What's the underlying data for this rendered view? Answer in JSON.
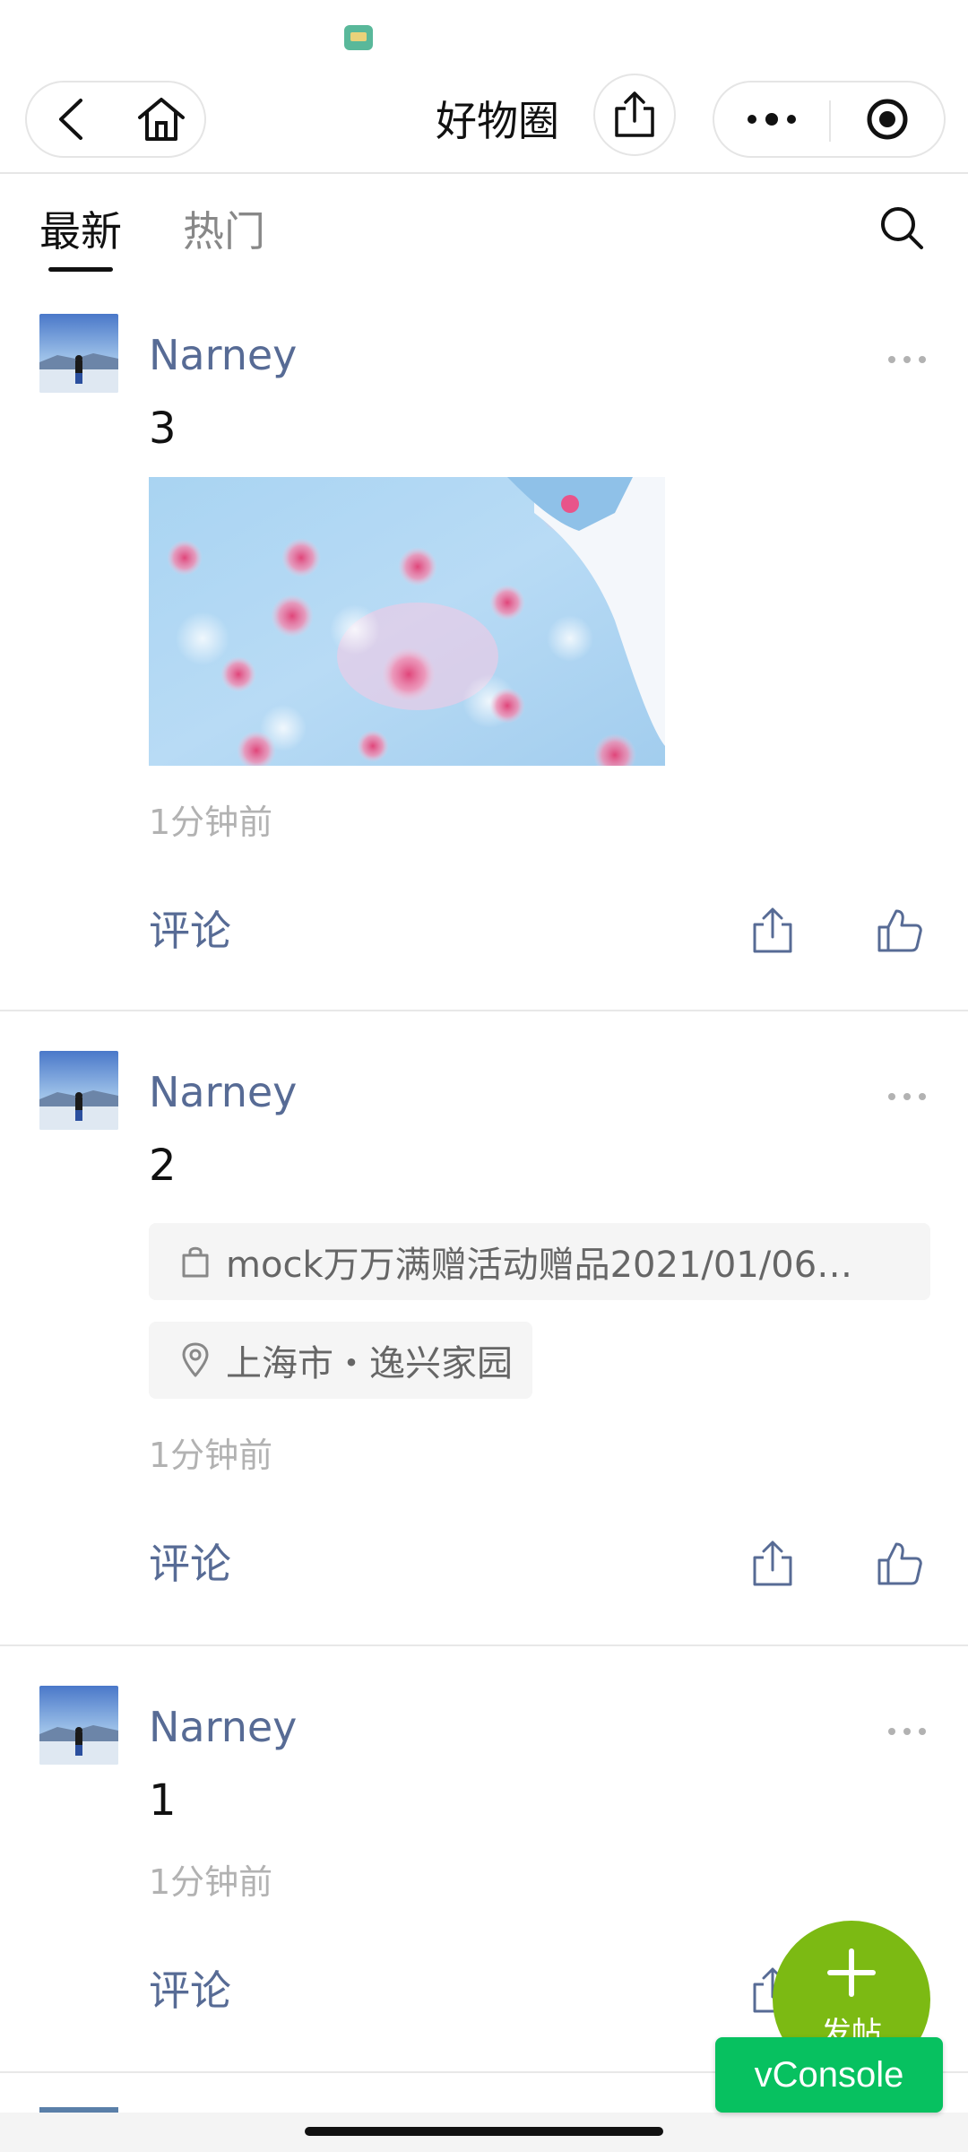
{
  "nav": {
    "title": "好物圈"
  },
  "tabs": {
    "latest": "最新",
    "hot": "热门"
  },
  "posts": [
    {
      "username": "Narney",
      "text": "3",
      "time": "1分钟前",
      "comment_label": "评论"
    },
    {
      "username": "Narney",
      "text": "2",
      "product_tag": "mock万万满赠活动赠品2021/01/06…",
      "location_tag": "上海市・逸兴家园",
      "time": "1分钟前",
      "comment_label": "评论"
    },
    {
      "username": "Narney",
      "text": "1",
      "time": "1分钟前",
      "comment_label": "评论"
    }
  ],
  "fab": {
    "label": "发帖"
  },
  "vconsole": {
    "label": "vConsole"
  },
  "colors": {
    "link_blue": "#576b95",
    "fab_green": "#7cba13",
    "vconsole_green": "#07c160"
  }
}
